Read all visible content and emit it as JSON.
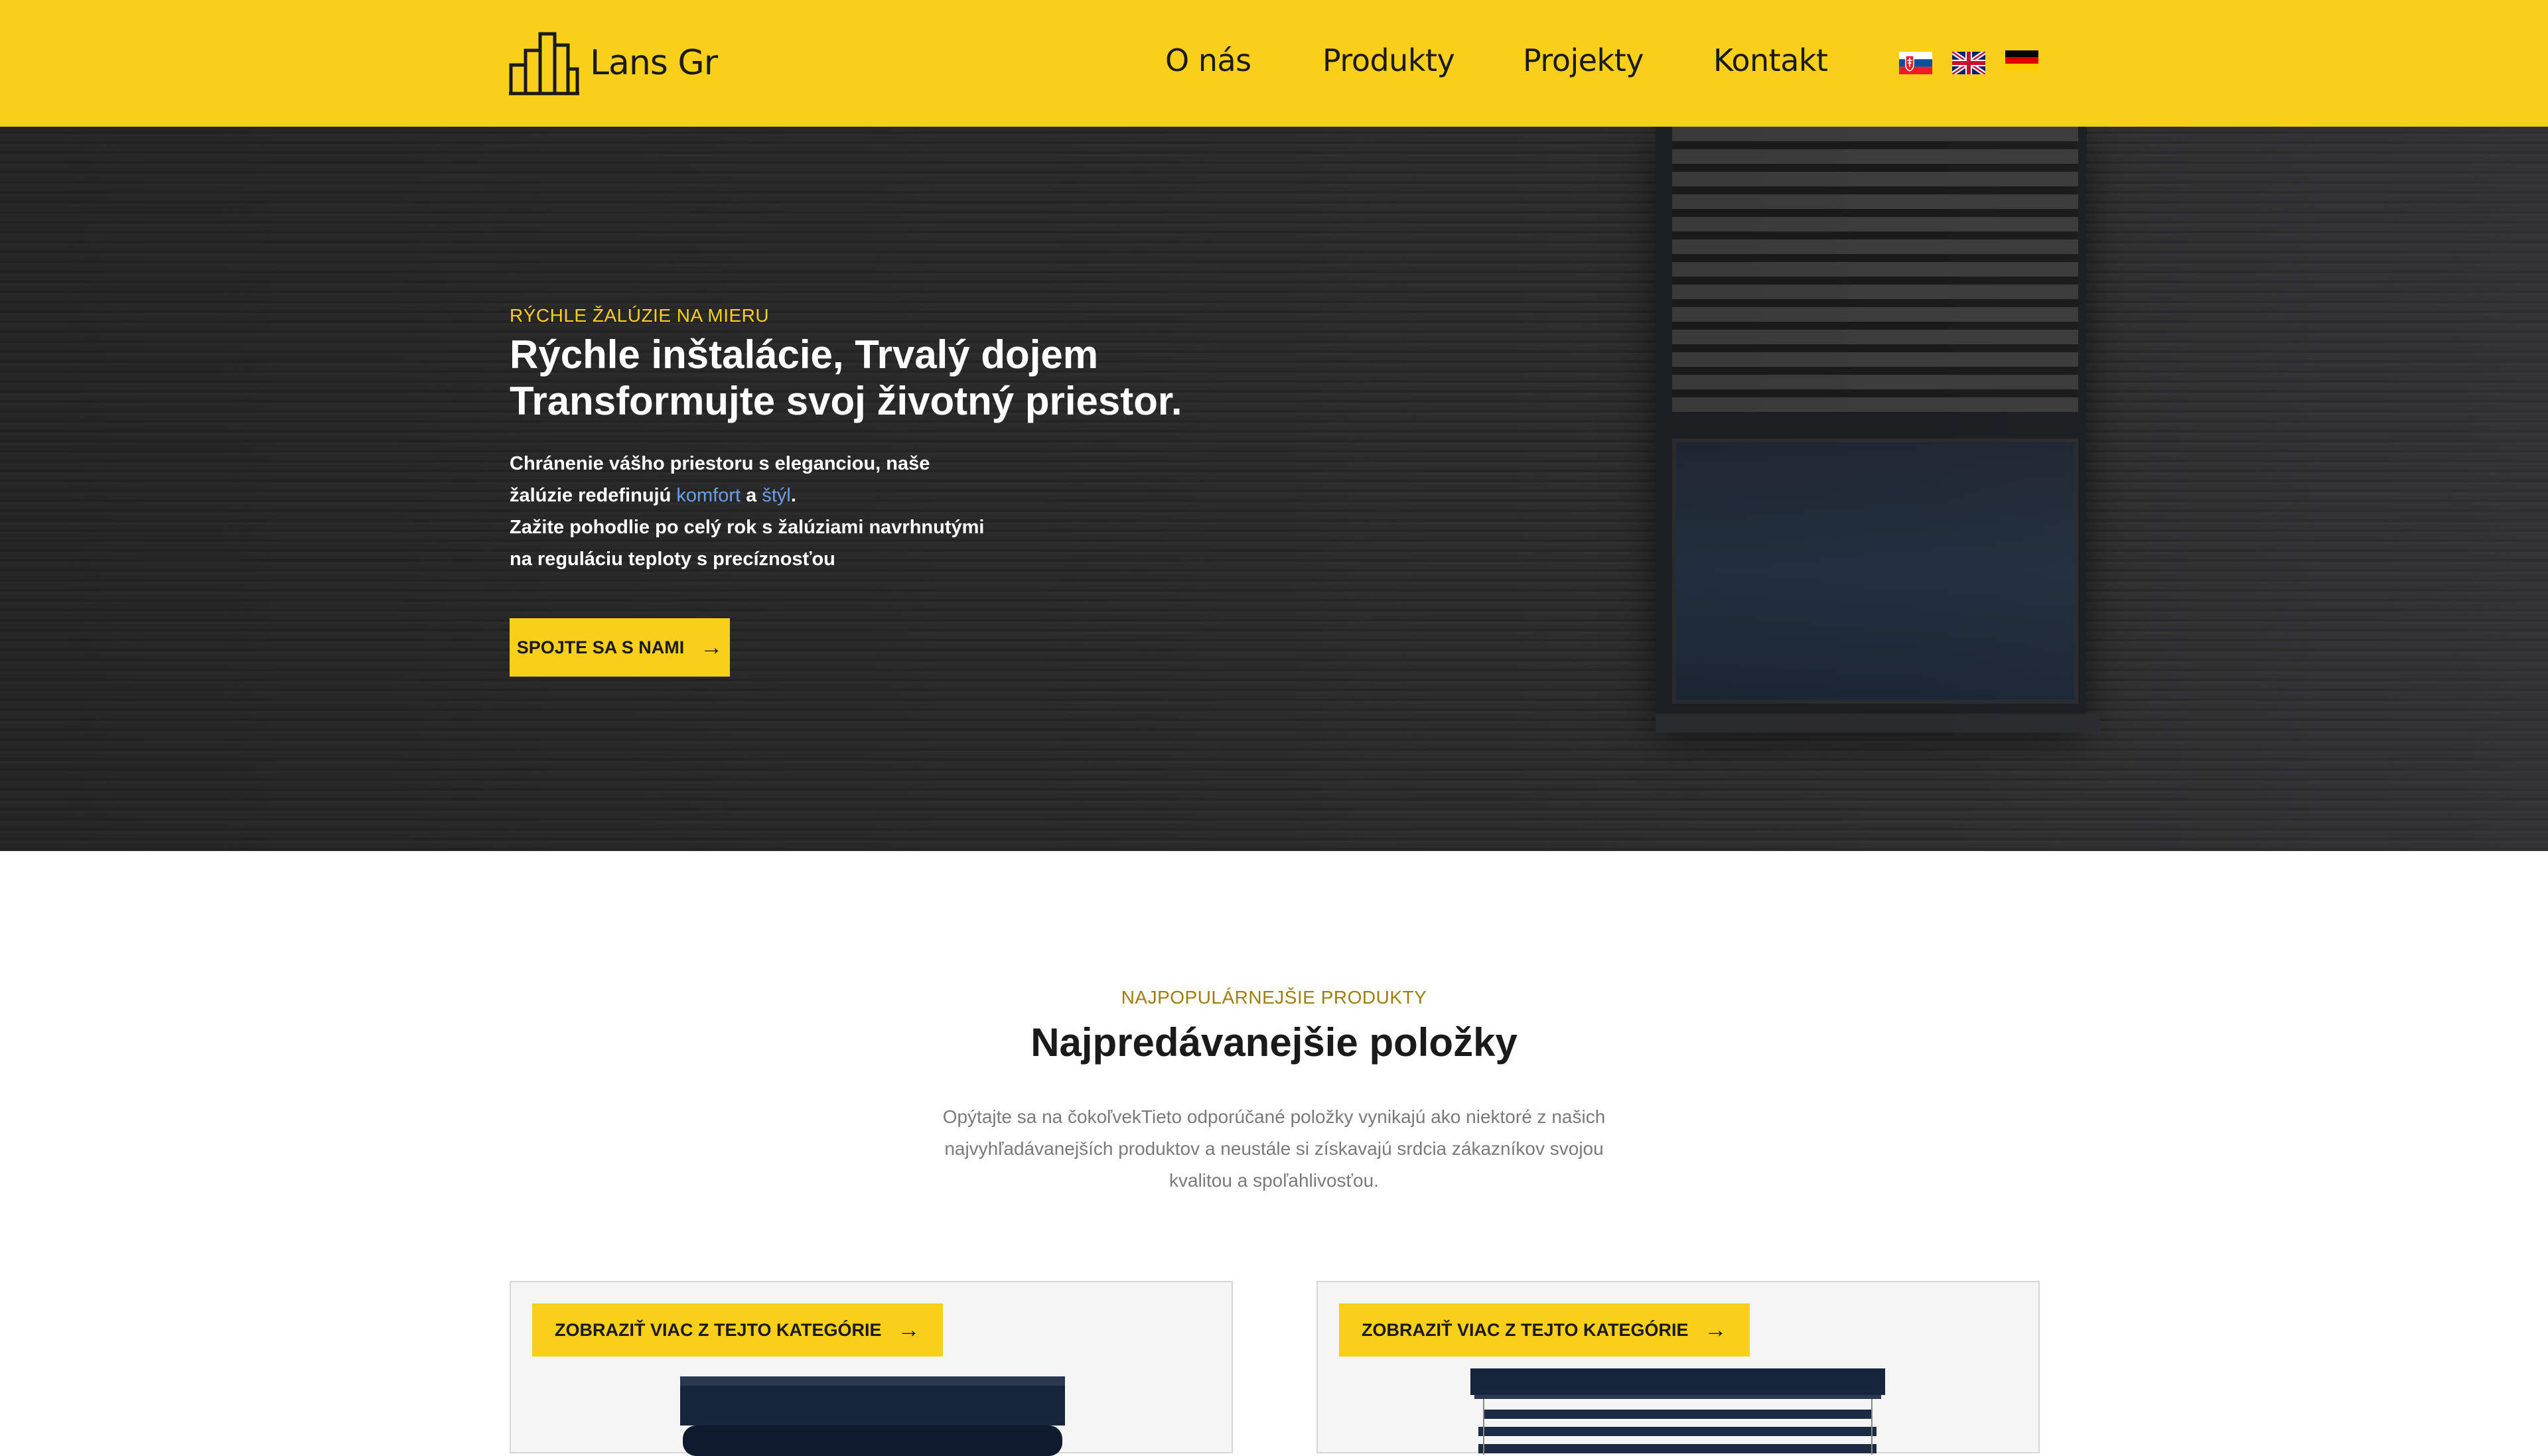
{
  "brand": {
    "name": "Lans Gr"
  },
  "nav": [
    {
      "label": "O nás"
    },
    {
      "label": "Produkty"
    },
    {
      "label": "Projekty"
    },
    {
      "label": "Kontakt"
    }
  ],
  "languages": [
    {
      "code": "sk",
      "icon": "slovak-flag-icon"
    },
    {
      "code": "en",
      "icon": "uk-flag-icon"
    },
    {
      "code": "de",
      "icon": "german-flag-icon"
    }
  ],
  "hero": {
    "eyebrow": "RÝCHLE ŽALÚZIE NA MIERU",
    "title": "Rýchle inštalácie, Trvalý dojem Transformujte svoj životný priestor.",
    "text_line1": "Chránenie vášho priestoru s eleganciou, naše",
    "text_line2_a": "žalúzie redefinujú ",
    "text_highlight1": "komfort",
    "text_and": " a ",
    "text_highlight2": "štýl",
    "text_dot": ".",
    "text_line3": "Zažite pohodlie po celý rok s žalúziami navrhnutými",
    "text_line4": "na reguláciu teploty s precíznosťou",
    "cta_label": "SPOJTE SA S NAMI",
    "cta_icon": "arrow-right-icon"
  },
  "products": {
    "eyebrow": "NAJPOPULÁRNEJŠIE PRODUKTY",
    "title": "Najpredávanejšie položky",
    "description": "Opýtajte sa na čokoľvekTieto odporúčané položky vynikajú ako niektoré z našich najvyhľadávanejších produktov a neustále si získavajú srdcia zákazníkov svojou kvalitou a spoľahlivosťou.",
    "cards": [
      {
        "button_label": "ZOBRAZIŤ VIAC Z TEJTO KATEGÓRIE"
      },
      {
        "button_label": "ZOBRAZIŤ VIAC Z TEJTO KATEGÓRIE"
      }
    ]
  },
  "colors": {
    "accent": "#f9cf1a",
    "highlight_link": "#6a9fe8",
    "eyebrow_dark": "#a07d10"
  }
}
